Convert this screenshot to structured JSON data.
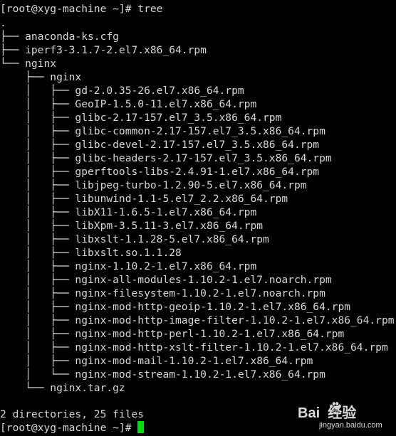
{
  "terminal": {
    "prompt_top": "[root@xyg-machine ~]# tree",
    "lines": [
      ".",
      "├── anaconda-ks.cfg",
      "├── iperf3-3.1.7-2.el7.x86_64.rpm",
      "└── nginx",
      "    ├── nginx",
      "    │   ├── gd-2.0.35-26.el7.x86_64.rpm",
      "    │   ├── GeoIP-1.5.0-11.el7.x86_64.rpm",
      "    │   ├── glibc-2.17-157.el7_3.5.x86_64.rpm",
      "    │   ├── glibc-common-2.17-157.el7_3.5.x86_64.rpm",
      "    │   ├── glibc-devel-2.17-157.el7_3.5.x86_64.rpm",
      "    │   ├── glibc-headers-2.17-157.el7_3.5.x86_64.rpm",
      "    │   ├── gperftools-libs-2.4.91-1.el7.x86_64.rpm",
      "    │   ├── libjpeg-turbo-1.2.90-5.el7.x86_64.rpm",
      "    │   ├── libunwind-1.1-5.el7_2.2.x86_64.rpm",
      "    │   ├── libX11-1.6.5-1.el7.x86_64.rpm",
      "    │   ├── libXpm-3.5.11-3.el7.x86_64.rpm",
      "    │   ├── libxslt-1.1.28-5.el7.x86_64.rpm",
      "    │   ├── libxslt.so.1.1.28",
      "    │   ├── nginx-1.10.2-1.el7.x86_64.rpm",
      "    │   ├── nginx-all-modules-1.10.2-1.el7.noarch.rpm",
      "    │   ├── nginx-filesystem-1.10.2-1.el7.noarch.rpm",
      "    │   ├── nginx-mod-http-geoip-1.10.2-1.el7.x86_64.rpm",
      "    │   ├── nginx-mod-http-image-filter-1.10.2-1.el7.x86_64.rpm",
      "    │   ├── nginx-mod-http-perl-1.10.2-1.el7.x86_64.rpm",
      "    │   ├── nginx-mod-http-xslt-filter-1.10.2-1.el7.x86_64.rpm",
      "    │   ├── nginx-mod-mail-1.10.2-1.el7.x86_64.rpm",
      "    │   └── nginx-mod-stream-1.10.2-1.el7.x86_64.rpm",
      "    └── nginx.tar.gz"
    ],
    "blank": "",
    "summary": "2 directories, 25 files",
    "prompt_bottom": "[root@xyg-machine ~]# "
  },
  "colors": {
    "background": "#000000",
    "text": "#d6d6d6",
    "cursor": "#00e000"
  },
  "watermark": {
    "brand": "Bai  经验",
    "site": "jingyan.baidu.com"
  },
  "icons": {
    "cursor": "block-cursor-icon",
    "watermark": "baidu-paw-icon"
  }
}
